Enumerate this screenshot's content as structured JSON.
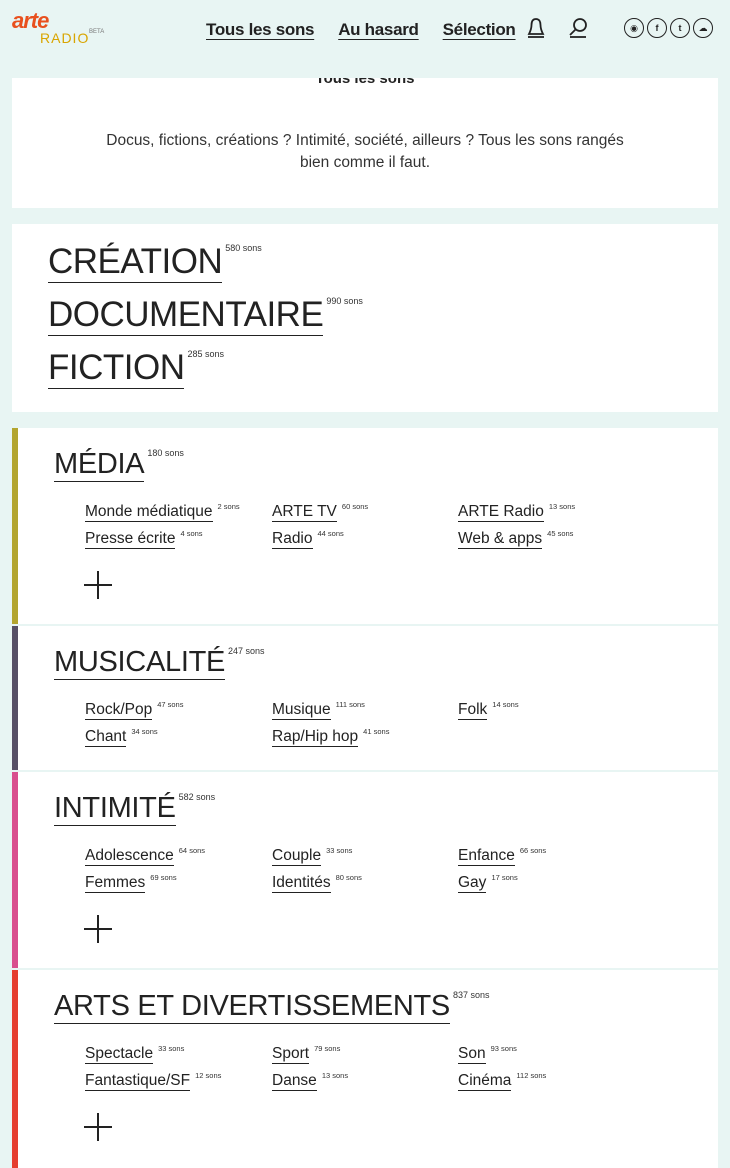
{
  "header": {
    "logo_top": "arte",
    "logo_bottom": "RADIO",
    "logo_badge": "BETA",
    "nav": [
      "Tous les sons",
      "Au hasard",
      "Sélection"
    ],
    "icons": [
      "user-icon",
      "search-icon"
    ],
    "social": [
      {
        "name": "rss-icon",
        "glyph": "◉"
      },
      {
        "name": "facebook-icon",
        "glyph": "f"
      },
      {
        "name": "twitter-icon",
        "glyph": "t"
      },
      {
        "name": "soundcloud-icon",
        "glyph": "☁"
      }
    ]
  },
  "intro": {
    "title": "Tous les sons",
    "description": "Docus, fictions, créations ? Intimité, société, ailleurs ? Tous les sons rangés bien comme il faut."
  },
  "big_categories": [
    {
      "label": "CRÉATION",
      "count": "580 sons"
    },
    {
      "label": "DOCUMENTAIRE",
      "count": "990 sons"
    },
    {
      "label": "FICTION",
      "count": "285 sons"
    }
  ],
  "themes": [
    {
      "label": "MÉDIA",
      "count": "180 sons",
      "color": "#b3a52f",
      "items": [
        {
          "label": "Monde médiatique",
          "count": "2 sons"
        },
        {
          "label": "ARTE TV",
          "count": "60 sons"
        },
        {
          "label": "ARTE Radio",
          "count": "13 sons"
        },
        {
          "label": "Presse écrite",
          "count": "4 sons"
        },
        {
          "label": "Radio",
          "count": "44 sons"
        },
        {
          "label": "Web & apps",
          "count": "45 sons"
        }
      ]
    },
    {
      "label": "MUSICALITÉ",
      "count": "247 sons",
      "color": "#575066",
      "items": [
        {
          "label": "Rock/Pop",
          "count": "47 sons"
        },
        {
          "label": "Musique",
          "count": "111 sons"
        },
        {
          "label": "Folk",
          "count": "14 sons"
        },
        {
          "label": "Chant",
          "count": "34 sons"
        },
        {
          "label": "Rap/Hip hop",
          "count": "41 sons"
        }
      ]
    },
    {
      "label": "INTIMITÉ",
      "count": "582 sons",
      "color": "#d94f8e",
      "items": [
        {
          "label": "Adolescence",
          "count": "64 sons"
        },
        {
          "label": "Couple",
          "count": "33 sons"
        },
        {
          "label": "Enfance",
          "count": "66 sons"
        },
        {
          "label": "Femmes",
          "count": "69 sons"
        },
        {
          "label": "Identités",
          "count": "80 sons"
        },
        {
          "label": "Gay",
          "count": "17 sons"
        }
      ]
    },
    {
      "label": "ARTS ET DIVERTISSEMENTS",
      "count": "837 sons",
      "color": "#e53e2f",
      "items": [
        {
          "label": "Spectacle",
          "count": "33 sons"
        },
        {
          "label": "Sport",
          "count": "79 sons"
        },
        {
          "label": "Son",
          "count": "93 sons"
        },
        {
          "label": "Fantastique/SF",
          "count": "12 sons"
        },
        {
          "label": "Danse",
          "count": "13 sons"
        },
        {
          "label": "Cinéma",
          "count": "112 sons"
        }
      ]
    }
  ]
}
